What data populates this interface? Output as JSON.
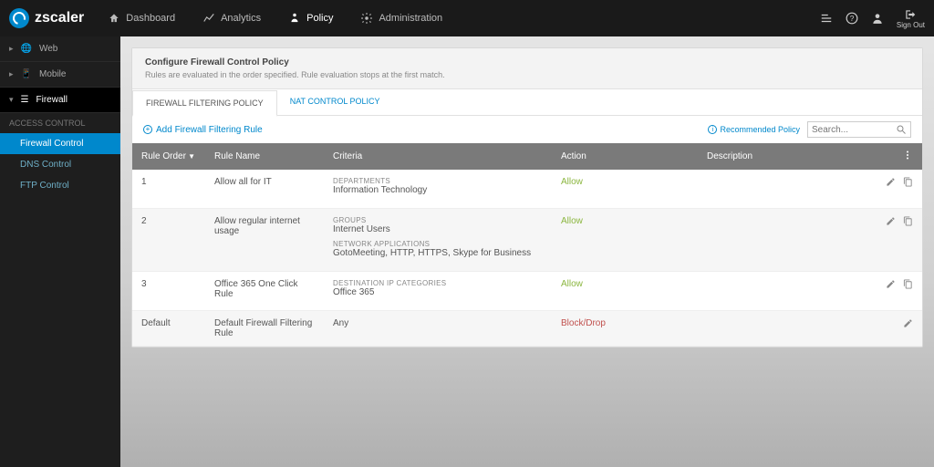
{
  "brand": "zscaler",
  "topnav": [
    {
      "label": "Dashboard"
    },
    {
      "label": "Analytics"
    },
    {
      "label": "Policy",
      "active": true
    },
    {
      "label": "Administration"
    }
  ],
  "signout_label": "Sign Out",
  "sidebar": {
    "groups": [
      {
        "label": "Web"
      },
      {
        "label": "Mobile"
      },
      {
        "label": "Firewall",
        "active": true
      }
    ],
    "section_label": "Access Control",
    "items": [
      {
        "label": "Firewall Control",
        "active": true
      },
      {
        "label": "DNS Control"
      },
      {
        "label": "FTP Control"
      }
    ]
  },
  "panel": {
    "title": "Configure Firewall Control Policy",
    "subtitle": "Rules are evaluated in the order specified. Rule evaluation stops at the first match."
  },
  "tabs": [
    {
      "label": "Firewall Filtering Policy",
      "active": true
    },
    {
      "label": "NAT Control Policy"
    }
  ],
  "add_link": "Add Firewall Filtering Rule",
  "recommended_link": "Recommended Policy",
  "search_placeholder": "Search...",
  "columns": {
    "order": "Rule Order",
    "name": "Rule Name",
    "criteria": "Criteria",
    "action": "Action",
    "description": "Description"
  },
  "rows": [
    {
      "order": "1",
      "name": "Allow all for IT",
      "criteria": [
        {
          "label": "Departments",
          "value": "Information Technology"
        }
      ],
      "action": "Allow",
      "action_class": "allow",
      "copyable": true
    },
    {
      "order": "2",
      "name": "Allow regular internet usage",
      "criteria": [
        {
          "label": "Groups",
          "value": "Internet Users"
        },
        {
          "label": "Network Applications",
          "value": "GotoMeeting, HTTP, HTTPS, Skype for Business"
        }
      ],
      "action": "Allow",
      "action_class": "allow",
      "copyable": true
    },
    {
      "order": "3",
      "name": "Office 365 One Click Rule",
      "criteria": [
        {
          "label": "Destination IP Categories",
          "value": "Office 365"
        }
      ],
      "action": "Allow",
      "action_class": "allow",
      "copyable": true
    },
    {
      "order": "Default",
      "name": "Default Firewall Filtering Rule",
      "criteria": [
        {
          "label": "",
          "value": "Any"
        }
      ],
      "action": "Block/Drop",
      "action_class": "block",
      "copyable": false
    }
  ]
}
